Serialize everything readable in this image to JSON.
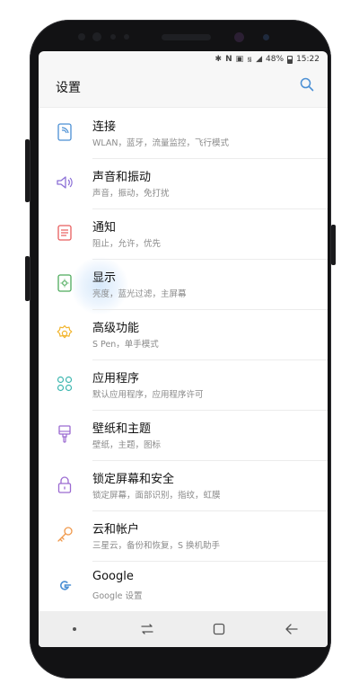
{
  "status": {
    "battery": "48%",
    "time": "15:22"
  },
  "header": {
    "title": "设置"
  },
  "settings": [
    {
      "label": "连接",
      "sub": "WLAN，蓝牙，流量监控，飞行模式",
      "icon": "connection-icon"
    },
    {
      "label": "声音和振动",
      "sub": "声音，振动，免打扰",
      "icon": "sound-icon"
    },
    {
      "label": "通知",
      "sub": "阻止，允许，优先",
      "icon": "notification-icon"
    },
    {
      "label": "显示",
      "sub": "亮度，蓝光过滤，主屏幕",
      "icon": "display-icon"
    },
    {
      "label": "高级功能",
      "sub": "S Pen，单手模式",
      "icon": "gear-icon"
    },
    {
      "label": "应用程序",
      "sub": "默认应用程序，应用程序许可",
      "icon": "apps-icon"
    },
    {
      "label": "壁纸和主题",
      "sub": "壁纸，主题，图标",
      "icon": "paintbrush-icon"
    },
    {
      "label": "锁定屏幕和安全",
      "sub": "锁定屏幕，面部识别，指纹，虹膜",
      "icon": "lock-icon"
    },
    {
      "label": "云和帐户",
      "sub": "三星云，备份和恢复，S 换机助手",
      "icon": "key-icon"
    },
    {
      "label": "Google",
      "sub": "Google 设置",
      "icon": "google-icon"
    }
  ],
  "colors": {
    "blue": "#4a8fd4",
    "orange": "#f0984a",
    "red": "#e85d5d",
    "green": "#4dab5c",
    "yellow": "#f2b52f",
    "teal": "#3eb7b0",
    "purple": "#9b6ad1",
    "lavender": "#8b6fd6"
  }
}
